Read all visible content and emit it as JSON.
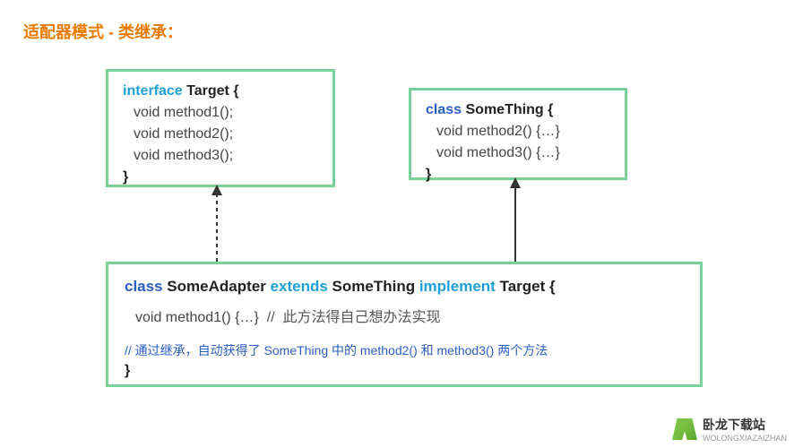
{
  "title": "适配器模式 - 类继承：",
  "target": {
    "kw": "interface",
    "name": "Target",
    "open": "{",
    "l1": "void method1();",
    "l2": "void method2();",
    "l3": "void method3();",
    "close": "}"
  },
  "something": {
    "kw": "class",
    "name": "SomeThing",
    "open": "{",
    "l1": "void method2() {…}",
    "l2": "void method3() {…}",
    "close": "}"
  },
  "adapter": {
    "kw_class": "class",
    "name": "SomeAdapter",
    "kw_extends": "extends",
    "parent": "SomeThing",
    "kw_implement": "implement",
    "iface": "Target",
    "open": "{",
    "method": "void method1() {…}",
    "comment_slash": "//",
    "comment1": "此方法得自己想办法实现",
    "comment2": "// 通过继承，自动获得了 SomeThing 中的 method2() 和 method3() 两个方法",
    "close": "}"
  },
  "watermark": {
    "cn": "卧龙下载站",
    "en": "WOLONGXIAZAIZHAN"
  }
}
